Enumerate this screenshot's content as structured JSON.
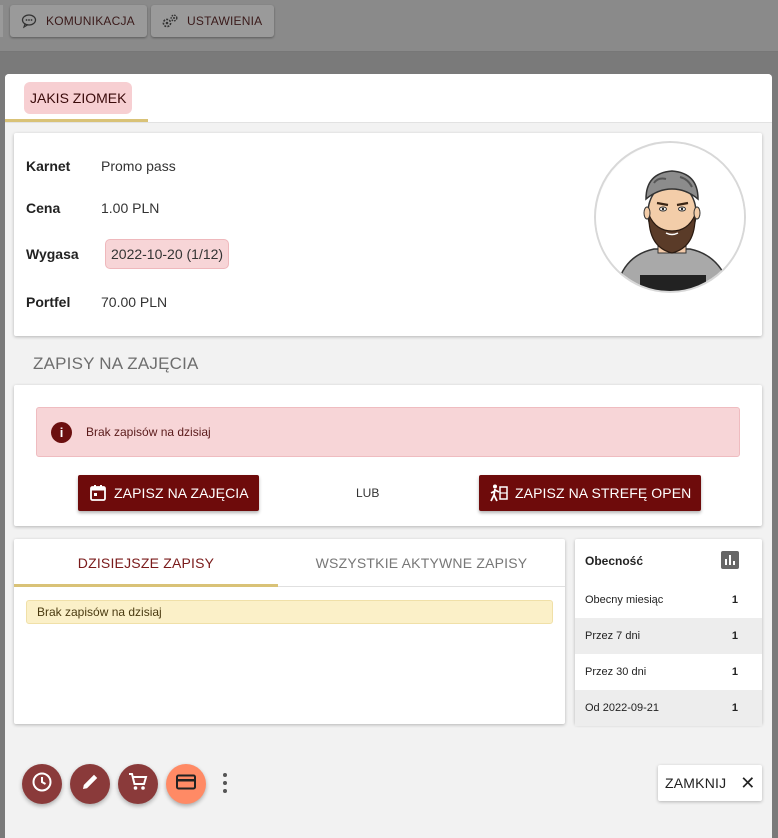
{
  "topnav": {
    "items": [
      {
        "label": "KOMUNIKACJA",
        "icon": "chat-icon"
      },
      {
        "label": "USTAWIENIA",
        "icon": "gears-icon"
      }
    ]
  },
  "member": {
    "tab_label": "JAKIS ZIOMEK",
    "fields": [
      {
        "label": "Karnet",
        "value": "Promo pass"
      },
      {
        "label": "Cena",
        "value": "1.00 PLN"
      },
      {
        "label": "Wygasa",
        "value": "2022-10-20 (1/12)"
      },
      {
        "label": "Portfel",
        "value": "70.00 PLN"
      }
    ]
  },
  "signup": {
    "section_title": "ZAPISY NA ZAJĘCIA",
    "alert_text": "Brak zapisów na dzisiaj",
    "class_button": "ZAPISZ NA ZAJĘCIA",
    "or_text": "LUB",
    "open_button": "ZAPISZ NA STREFĘ OPEN"
  },
  "bookings": {
    "tabs": [
      "DZISIEJSZE ZAPISY",
      "WSZYSTKIE AKTYWNE ZAPISY"
    ],
    "active_tab": 0,
    "empty_text": "Brak zapisów na dzisiaj"
  },
  "attendance": {
    "title": "Obecność",
    "rows": [
      {
        "label": "Obecny miesiąc",
        "value": "1"
      },
      {
        "label": "Przez 7 dni",
        "value": "1"
      },
      {
        "label": "Przez 30 dni",
        "value": "1"
      },
      {
        "label": "Od 2022-09-21",
        "value": "1"
      }
    ]
  },
  "footer": {
    "close_label": "ZAMKNIJ"
  },
  "colors": {
    "accent_dark": "#6e0b0b",
    "tab_underline": "#d9c277",
    "fab": "#8a3a3a",
    "fab_active": "#ff8a65"
  }
}
